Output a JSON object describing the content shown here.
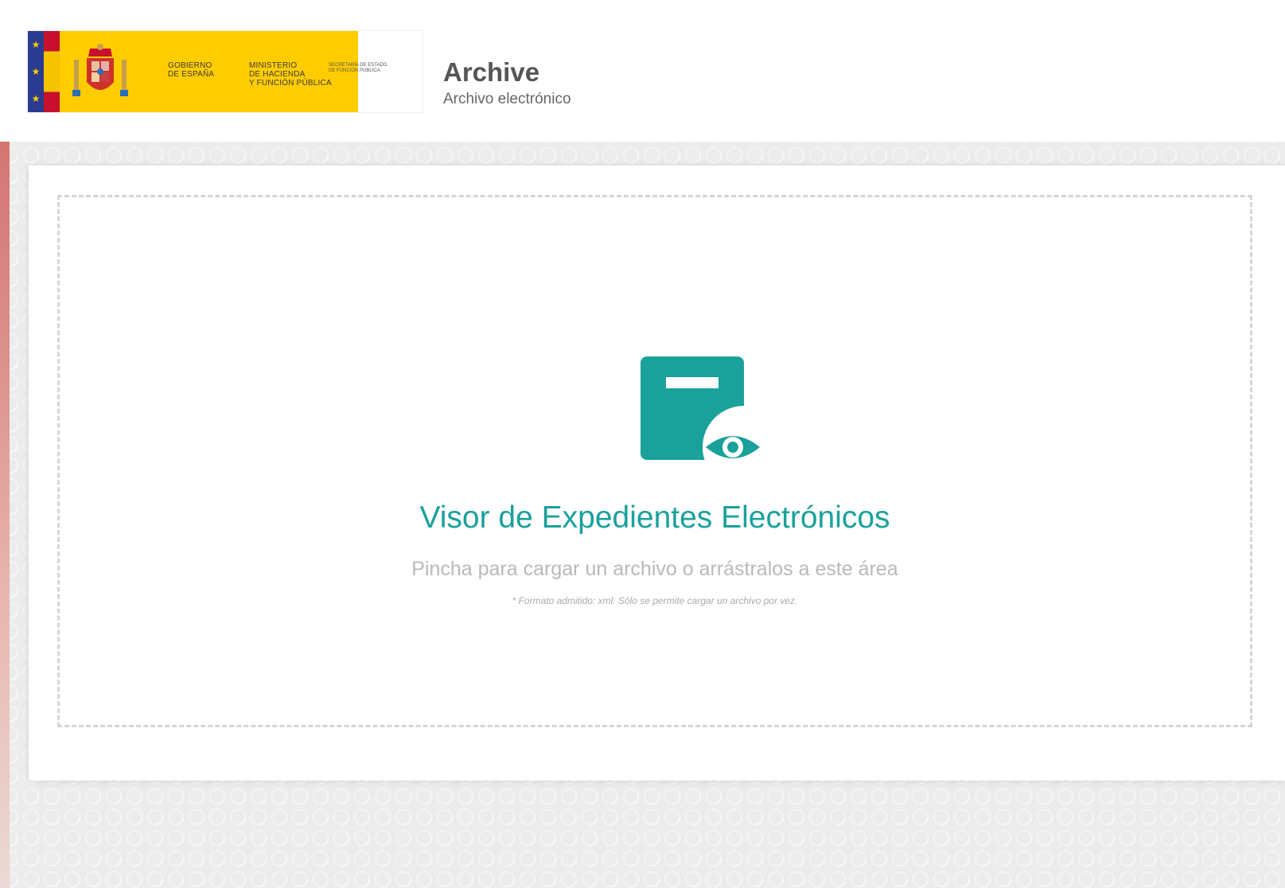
{
  "header": {
    "gov_label": "GOBIERNO\nDE ESPAÑA",
    "ministry_label": "MINISTERIO\nDE HACIENDA\nY FUNCIÓN PÚBLICA",
    "secretariat_label": "SECRETARÍA DE ESTADO\nDE FUNCIÓN PÚBLICA",
    "app_title": "Archive",
    "app_subtitle": "Archivo electrónico"
  },
  "dropzone": {
    "icon": "document-view-icon",
    "title": "Visor de Expedientes Electrónicos",
    "instruction": "Pincha para cargar un archivo o arrástralos a este área",
    "note": "* Formato admitido: xml. Sólo se permite cargar un archivo por vez."
  },
  "colors": {
    "accent": "#1aa19c",
    "gov_yellow": "#ffcc00",
    "flag_blue": "#2b3b8f",
    "flag_red": "#c8102e"
  }
}
